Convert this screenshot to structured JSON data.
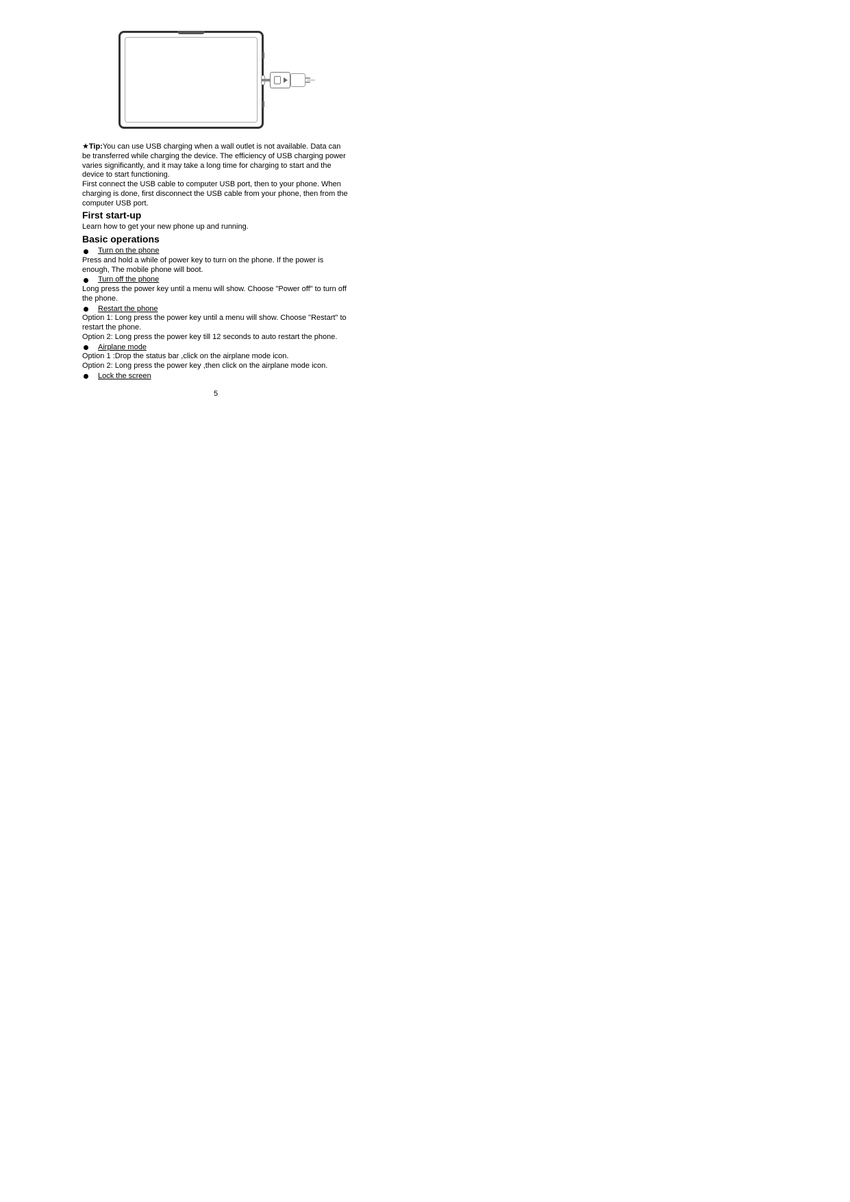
{
  "tip": {
    "star": "★",
    "label": "Tip:",
    "text": "You can use USB charging when a wall outlet is not available. Data can be transferred while charging the device. The efficiency of USB charging power varies significantly, and it may take a long time for charging to start and the"
  },
  "tip_cont": "device to start functioning.",
  "tip_para2": "First connect the USB cable to computer USB port, then to your phone. When charging is done, first disconnect the USB cable from your phone, then from the computer USB port.",
  "h1": "First start-up",
  "p1": "Learn how to get your new phone up and running.",
  "h2": "Basic operations",
  "b1": {
    "title": "Turn on the phone",
    "text": "Press and hold a while of power key to turn on the phone. If the power is enough, The mobile phone will boot."
  },
  "b2": {
    "title": "Turn off the phone",
    "text": "Long press the power key until a menu will show. Choose \"Power off\" to turn off the phone."
  },
  "b3": {
    "title": "Restart the phone",
    "text1": "Option 1: Long press the power key until a menu will show. Choose \"Restart\" to restart the phone.",
    "text2": "Option 2: Long press the power key till 12 seconds to auto restart the phone."
  },
  "b4": {
    "title": "Airplane mode",
    "text1": "Option 1 :Drop the status bar ,click on the airplane mode icon.",
    "text2": "Option 2: Long press the power key ,then click on the airplane mode icon."
  },
  "b5": {
    "title": "Lock the screen"
  },
  "page_number": "5"
}
